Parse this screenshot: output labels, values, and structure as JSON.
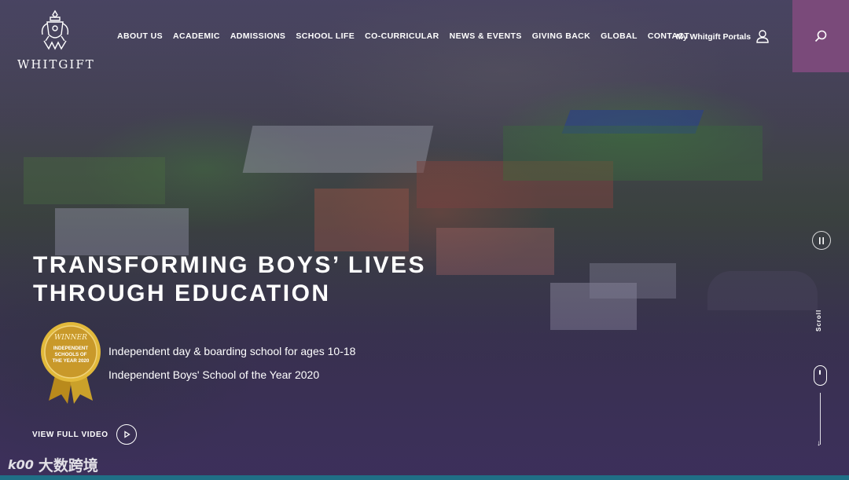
{
  "brand": {
    "name": "WHITGIFT"
  },
  "nav": {
    "items": [
      "ABOUT US",
      "ACADEMIC",
      "ADMISSIONS",
      "SCHOOL LIFE",
      "CO-CURRICULAR",
      "NEWS & EVENTS",
      "GIVING BACK",
      "GLOBAL",
      "CONTACT"
    ],
    "portals_label": "My Whitgift Portals"
  },
  "hero": {
    "headline_line1": "TRANSFORMING BOYS’ LIVES",
    "headline_line2": "THROUGH EDUCATION",
    "subline1": "Independent day & boarding school for ages 10-18",
    "subline2": "Independent Boys' School of the Year 2020",
    "video_label": "VIEW FULL VIDEO",
    "scroll_label": "Scroll"
  },
  "award_badge": {
    "top_text": "WINNER",
    "line1": "INDEPENDENT",
    "line2": "SCHOOLS OF",
    "line3": "THE YEAR 2020"
  },
  "watermark": {
    "logo_text": "k00",
    "text": "大数跨境"
  },
  "colors": {
    "accent_search_bg": "#7a4a7a",
    "bottom_strip": "#1f6f86",
    "badge_gold": "#d4a82a"
  },
  "icons": {
    "search": "search-icon",
    "user": "user-icon",
    "play": "play-icon",
    "pause": "pause-icon",
    "scroll_mouse": "mouse-icon",
    "scroll_arrow": "arrow-down-icon"
  }
}
